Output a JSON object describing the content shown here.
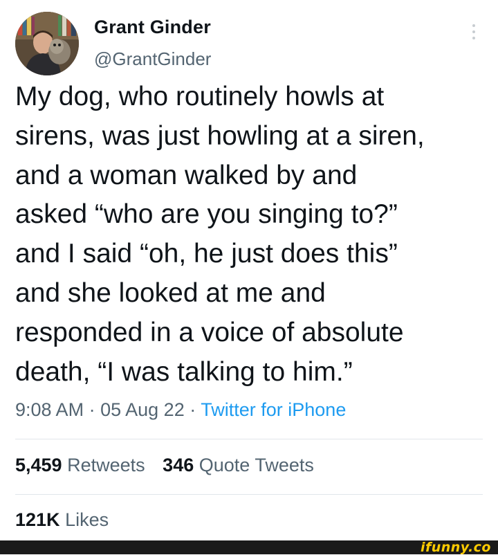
{
  "author": {
    "display_name": "Grant Ginder",
    "handle": "@GrantGinder"
  },
  "tweet": {
    "lines": [
      "My dog, who routinely howls at",
      "sirens, was just howling at a siren,",
      "and a woman walked by and",
      "asked “who are you singing to?”",
      "and I said “oh, he just does this”",
      "and she looked at me and",
      "responded in a voice of absolute",
      "death, “I was talking to him.”"
    ]
  },
  "meta": {
    "time": "9:08 AM",
    "separator": "·",
    "date": "05 Aug 22",
    "source": "Twitter for iPhone"
  },
  "stats": {
    "retweets_count": "5,459",
    "retweets_label": "Retweets",
    "quotes_count": "346",
    "quotes_label": "Quote Tweets",
    "likes_count": "121K",
    "likes_label": "Likes"
  },
  "watermark": {
    "text": "ifunny.co"
  },
  "colors": {
    "text": "#0f1419",
    "secondary": "#536471",
    "link": "#1d9bf0",
    "watermark": "#ffcc00"
  },
  "icons": {
    "more": "more-vertical-icon"
  }
}
